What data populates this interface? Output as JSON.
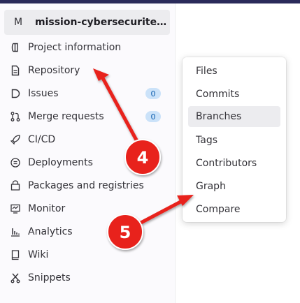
{
  "project": {
    "avatar_letter": "M",
    "name": "mission-cybersecurite-git..."
  },
  "sidebar": {
    "items": [
      {
        "label": "Project information",
        "icon": "info-icon"
      },
      {
        "label": "Repository",
        "icon": "document-icon"
      },
      {
        "label": "Issues",
        "icon": "issues-icon",
        "badge": "0"
      },
      {
        "label": "Merge requests",
        "icon": "merge-request-icon",
        "badge": "0"
      },
      {
        "label": "CI/CD",
        "icon": "rocket-icon"
      },
      {
        "label": "Deployments",
        "icon": "deployments-icon"
      },
      {
        "label": "Packages and registries",
        "icon": "package-icon"
      },
      {
        "label": "Monitor",
        "icon": "monitor-icon"
      },
      {
        "label": "Analytics",
        "icon": "chart-icon"
      },
      {
        "label": "Wiki",
        "icon": "book-icon"
      },
      {
        "label": "Snippets",
        "icon": "scissors-icon"
      }
    ]
  },
  "flyout": {
    "items": [
      {
        "label": "Files"
      },
      {
        "label": "Commits"
      },
      {
        "label": "Branches"
      },
      {
        "label": "Tags"
      },
      {
        "label": "Contributors"
      },
      {
        "label": "Graph"
      },
      {
        "label": "Compare"
      }
    ],
    "active": "Branches"
  },
  "annotations": {
    "marker_4": "4",
    "marker_5": "5"
  },
  "colors": {
    "annotation": "#e8211d",
    "badge_bg": "#cbe2f9",
    "badge_text": "#0b5cad",
    "active_bg": "#ececef"
  }
}
